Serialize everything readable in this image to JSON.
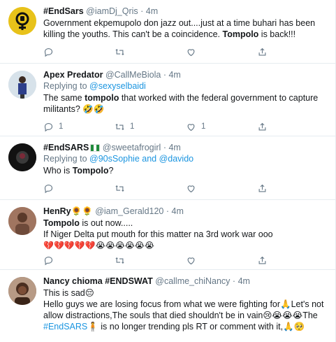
{
  "tweets": [
    {
      "name": "#EndSars",
      "handle": "@iamDj_Qris",
      "sep": "·",
      "time": "4m",
      "reply_prefix": "",
      "reply_to": "",
      "text_a": "Government ekpemupolo don jazz out....just at a time buhari has been killing the youths. This can't be a coincidence. ",
      "bold": "Tompolo",
      "text_b": " is back!!!",
      "reply_count": "",
      "retweet_count": "",
      "like_count": "",
      "avatar_color": "#e8c21a"
    },
    {
      "name": "Apex Predator",
      "handle": "@CallMeBiola",
      "sep": "·",
      "time": "4m",
      "reply_prefix": "Replying to ",
      "reply_to": "@sexyselbaidi",
      "text_a": "The same ",
      "bold": "tompolo",
      "text_b": " that worked with the federal government to capture militants? 🤣🤣",
      "reply_count": "1",
      "retweet_count": "1",
      "like_count": "1",
      "avatar_color": "#c9d6e3"
    },
    {
      "name": "#EndSARS",
      "handle": "@sweetafrogirl",
      "sep": "·",
      "time": "4m",
      "reply_prefix": "Replying to ",
      "reply_to": "@90sSophie and @davido",
      "text_a": "Who is ",
      "bold": "Tompolo",
      "text_b": "?",
      "reply_count": "",
      "retweet_count": "",
      "like_count": "",
      "avatar_color": "#1a1a1a"
    },
    {
      "name": "HenRy🌻🌻",
      "handle": "@iam_Gerald120",
      "sep": "·",
      "time": "4m",
      "reply_prefix": "",
      "reply_to": "",
      "bold": "Tompolo",
      "text_b": " is out now.....",
      "line2": "If Niger Delta put mouth for this matter na 3rd work war ooo",
      "line3": "💔💔💔💔💔😭😭😭😭😭😭",
      "reply_count": "",
      "retweet_count": "",
      "like_count": "",
      "avatar_color": "#9b6b4e"
    },
    {
      "name": "Nancy chioma #ENDSWAT",
      "handle": "@callme_chiNancy",
      "sep": "·",
      "time": "4m",
      "line1": "This is sad😔",
      "line2": "Hello guys we are losing focus from what we were fighting for🙏Let's not allow distractions,The souls that died shouldn't be in vain😢😭😭😭The ",
      "hashtag": "#EndSARS",
      "line2b": "🧍 is no longer trending pls RT or comment with it,🙏🥺",
      "avatar_color": "#6b4a35"
    }
  ],
  "icons": [
    "reply-icon",
    "retweet-icon",
    "like-icon",
    "share-icon"
  ]
}
